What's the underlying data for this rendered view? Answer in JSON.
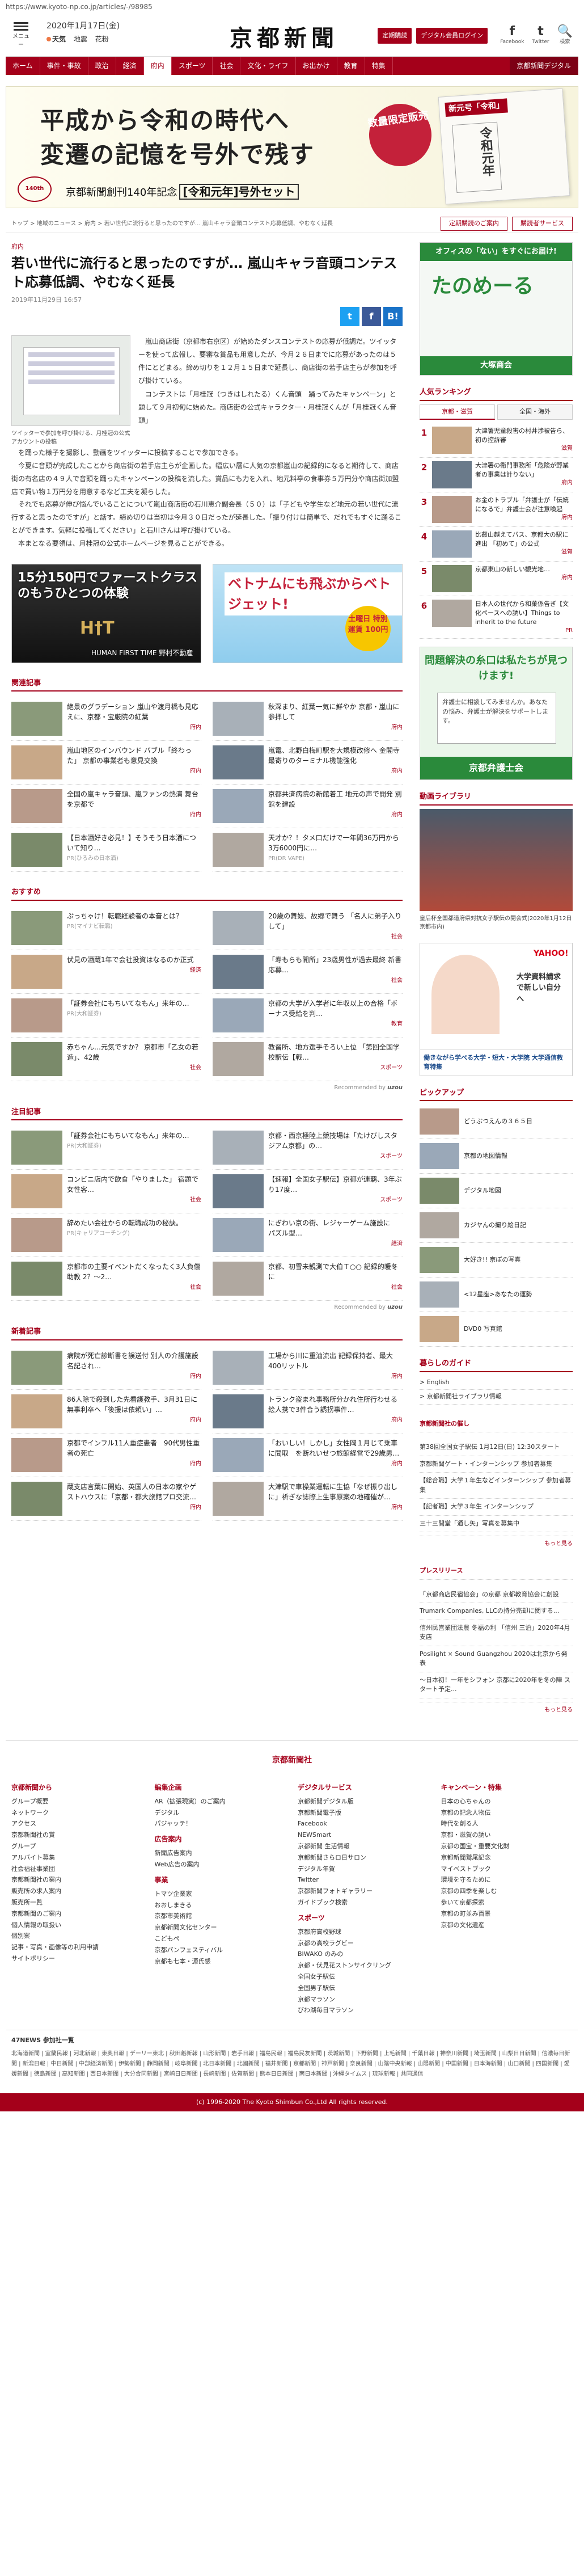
{
  "url": "https://www.kyoto-np.co.jp/articles/-/98985",
  "header": {
    "menu_label": "メニュー",
    "date": "2020年1月17日(金)",
    "weather": [
      "天気",
      "地震",
      "花粉"
    ],
    "logo": "京都新聞",
    "btn_subscribe": "定期購読",
    "btn_digital": "デジタル会員ログイン",
    "social": [
      {
        "glyph": "f",
        "label": "Facebook"
      },
      {
        "glyph": "t",
        "label": "Twitter"
      },
      {
        "glyph": "🔍",
        "label": "検索"
      }
    ]
  },
  "nav": [
    "ホーム",
    "事件・事故",
    "政治",
    "経済",
    "府内",
    "スポーツ",
    "社会",
    "文化・ライフ",
    "お出かけ",
    "教育",
    "特集",
    "京都新聞デジタル"
  ],
  "nav_active": 4,
  "banner": {
    "line1": "平成から令和の時代へ",
    "line2": "変遷の記憶を号外で残す",
    "stamp": "数量限定販売",
    "emblem": "140th",
    "note": "京都新聞創刊140年記念",
    "note_bold": "[令和元年]号外セット",
    "paper_title": "新元号「令和」",
    "paper_body": "令和元年"
  },
  "breadcrumb": "トップ > 地域のニュース > 府内 > 若い世代に流行ると思ったのですが… 嵐山キャラ音頭コンテスト応募低調、やむなく延長",
  "crumb_btns": [
    "定期購読のご案内",
    "購読者サービス"
  ],
  "article": {
    "category": "府内",
    "title": "若い世代に流行ると思ったのですが… 嵐山キャラ音頭コンテスト応募低調、やむなく延長",
    "date": "2019年11月29日 16:57",
    "share": [
      "t",
      "f",
      "B!"
    ],
    "photo_caption": "ツイッターで参加を呼び掛ける、月桂冠の公式アカウントの投稿",
    "paragraphs_side": [
      "嵐山商店街（京都市右京区）が始めたダンスコンテストの応募が低調だ。ツイッターを使って広報し、要審な賞品も用意したが、今月２６日までに応募があったのは５件にとどまる。締め切りを１２月１５日まで延長し、商店街の若手店主らが参加を呼び掛けている。",
      "コンテストは「月桂冠（つきはしれたる）くん音頭　踊ってみたキャンペーン」と題して９月初旬に始めた。商店街の公式キャラクター・月桂冠くんが「月桂冠くん音頭」"
    ],
    "paragraphs_full": [
      "を踊った様子を撮影し、動画をツイッターに投稿することで参加できる。",
      "今夏に音頭が完成したことから商店街の若手店主らが企画した。幅広い層に人気の京都嵐山の記録的になると期待して、商店街の有名店の４９人で音頭を踊ったキャンペーンの投稿を流した。賞品にも力を入れ、地元料亭の食事券５万円分や商店街加盟店で買い物１万円分を用意するなど工夫を凝らした。",
      "それでも応募が伸び悩んでいることについて嵐山商店街の石川恵介副会長（５０）は「子どもや学生など地元の若い世代に流行すると思ったのですが」と話す。締め切りは当初は今月３０日だったが延長した。「振り付けは簡単で、だれでもすぐに踊ることができます。気軽に投稿してください」と石川さんは呼び掛けている。",
      "本まとなる要領は、月桂冠の公式ホームページを見ることができる。"
    ]
  },
  "ads": {
    "ad1_title": "15分150円でファーストクラスのもうひとつの体験",
    "ad1_logo": "H†T",
    "ad1_sub": "HUMAN FIRST TIME",
    "ad1_brand": "野村不動産",
    "ad2_title": "ベトナムにも飛ぶからベトジェット!",
    "ad2_badge": "土曜日 特別運賃 100円"
  },
  "related": {
    "heading": "関連記事",
    "items": [
      {
        "text": "絶景のグラデーション 嵐山や渡月橋も見応えに、京都・宝厳院の紅葉",
        "tag": "府内"
      },
      {
        "text": "秋深まり、紅葉一気に鮮やか 京都・嵐山に参拝して",
        "tag": "府内"
      },
      {
        "text": "嵐山地区のインバウンド バブル「終わった」 京都の事業者も意見交換",
        "tag": "府内"
      },
      {
        "text": "嵐電、北野白梅町駅を大規模改修へ 金閣寺最寄りのターミナル機能強化",
        "tag": "府内"
      },
      {
        "text": "全国の嵐キャラ音頭、嵐ファンの熱演 舞台を京都で",
        "tag": "府内"
      },
      {
        "text": "京都共済病院の新館着工 地元の声で開発 別館を建設",
        "tag": "府内"
      },
      {
        "text": "【日本酒好き必見！】そうそう日本酒について知り…",
        "pr": "PR(ひろみの日本酒)"
      },
      {
        "text": "天才か？！タメ口だけで一年間36万円から3万6000円に…",
        "pr": "PR(DR VAPE)"
      }
    ]
  },
  "recommend": {
    "heading": "おすすめ",
    "items": [
      {
        "text": "ぷっちゃけ！転職経験者の本音とは？",
        "pr": "PR(マイナビ転職)"
      },
      {
        "text": "20歳の舞妓、故郷で舞う 「名人に弟子入りして」",
        "tag": "社会"
      },
      {
        "text": "伏見の酒蔵1年で会社投資はなるのか正式",
        "tag": "経済"
      },
      {
        "text": "「寿もらも開所」23歳男性が過去最終 新書応募…",
        "tag": "社会"
      },
      {
        "text": "「証券会社にもちいてなもん」来年の…",
        "pr": "PR(大和証券)"
      },
      {
        "text": "京都の大学が入学者に年収以上の合格「ボーナス受給を判…",
        "tag": "教育"
      },
      {
        "text": "赤ちゃん…元気ですか？ 京都市「乙女の若造」、42歳",
        "tag": "社会"
      },
      {
        "text": "教習所、地方選手そろい上位 「第回全国学校駅伝【戦…",
        "tag": "スポーツ"
      }
    ],
    "reco_label": "Recommended by",
    "reco_brand": "uzou"
  },
  "attention": {
    "heading": "注目記事",
    "items": [
      {
        "text": "「証券会社にもちいてなもん」来年の…",
        "pr": "PR(大和証券)"
      },
      {
        "text": "京都・西京極陸上競技場は「たけびしスタジアム京都」の…",
        "tag": "スポーツ"
      },
      {
        "text": "コンビニ店内で飲食「やりました」 宿題で女性客…",
        "tag": "社会"
      },
      {
        "text": "【速報】全国女子駅伝】京都が連覇、3年ぶり17度…",
        "tag": "スポーツ"
      },
      {
        "text": "辞めたい会社からの転職成功の秘訣。",
        "pr": "PR(キャリアコーチング)"
      },
      {
        "text": "にぎわい京の街、レジャーゲーム施設に　パズル型…",
        "tag": "経済"
      },
      {
        "text": "京都市の主要イベントだくなったく3人負傷助教 2？～2…",
        "tag": "社会"
      },
      {
        "text": "京都、初雪未観測で大伯Ｔ○○ 記録的暖冬に",
        "tag": "社会"
      }
    ],
    "reco_label": "Recommended by",
    "reco_brand": "uzou"
  },
  "latest": {
    "heading": "新着記事",
    "items": [
      {
        "text": "病院が死亡診断書を誤送付 別人の介護施設名記され…",
        "tag": "府内"
      },
      {
        "text": "工場から川に重油流出 記録保持者、最大400リットル",
        "tag": "府内"
      },
      {
        "text": "86人除で殺到した先看護教手、3月31日に無事利卒へ「後援は依頼い」…",
        "tag": "府内"
      },
      {
        "text": "トランク盗まれ事務所分かれ住所行わせる　絵人携で3件合う誘拐事件…",
        "tag": "府内"
      },
      {
        "text": "京都でインフル11人重症患者　90代男性重者の死亡",
        "tag": "府内"
      },
      {
        "text": "「おいしい！しかし」女性岡１月じて乗車に聞取　を断れいせつ旅館経営で29歳男…",
        "tag": "府内"
      },
      {
        "text": "蔵支店言葉に開始、英国人の日本の家やゲストハウスに「京都・都大旅館プロ交流…",
        "tag": "府内"
      },
      {
        "text": "大津駅で車操業運転に生協「なぜ振り出しに」祈ぎな誌際上生事原案の地確催が…",
        "tag": "府内"
      }
    ]
  },
  "sidebar": {
    "ad_tanomail_top": "オフィスの「ない」をすぐにお届け!",
    "ad_tanomail_logo": "たのめーる",
    "ad_tanomail_brand": "大塚商会",
    "ranking_heading": "人気ランキング",
    "ranking_tabs": [
      "京都・滋賀",
      "全国・海外"
    ],
    "ranking": [
      {
        "n": "1",
        "text": "大津署児童殺害の村井渉被告ら、初の控訴審",
        "tag": "滋賀"
      },
      {
        "text": "大津署の衛門事務所「危険が野業者の事業は計りない」",
        "n": "2",
        "tag": "府内"
      },
      {
        "n": "3",
        "text": "お金のトラブル「弁護士が「伝統になるで」弁護士会が注意喚起",
        "tag": "府内"
      },
      {
        "n": "4",
        "text": "比叡山越えてバス、京都大の駅に進出 「初めて」の公式",
        "tag": "滋賀"
      },
      {
        "n": "5",
        "text": "京都東山の新しい観光地…",
        "tag": "府内"
      },
      {
        "n": "6",
        "text": "日本人の世代から和菓係告ぎ【文化ペースへの誘い】Things to inherit to the future",
        "tag": "PR"
      }
    ],
    "ad_bengoshi_title": "問題解決の糸口は私たちが見つけます!",
    "ad_bengoshi_box": "弁護士に相談してみませんか。あなたの悩み、弁護士が解決をサポートします。",
    "ad_bengoshi_brand": "京都弁護士会",
    "library_heading": "動画ライブラリ",
    "library_caption": "皇后杯全国都道府県対抗女子駅伝の開会式(2020年1月12日 京都市内)",
    "ad_yahoo_logo": "YAHOO!",
    "ad_yahoo_title": "大学資料請求で新しい自分へ",
    "ad_yahoo_bottom": "働きながら学べる大学・短大・大学院 大学通信教育特集",
    "pickup_heading": "ピックアップ",
    "pickup": [
      "どうぶつえんの３６５日",
      "京都の地図情報",
      "デジタル地図",
      "カジヤんの撮り絵日記",
      "大好き!! 京ぽの写真",
      "<12星座>あなたの運勢",
      "DVD0 写真館"
    ],
    "guide_heading": "暮らしのガイド",
    "guide": [
      "> English",
      "> 京都新聞社ライブラリ情報"
    ],
    "events_heading": "京都新聞社の催し",
    "events": [
      "第38回全国女子駅伝 1月12日(日) 12:30スタート",
      "京都新聞ゲート・インターンシップ 参加者募集",
      "【総合職】大学１年生などインターンシップ 参加者募集",
      "【記者職】大学３年生 インターンシップ",
      "三十三間堂「通し矢」写真を募集中"
    ],
    "events_more": "もっと見る",
    "press_heading": "プレスリリース",
    "press": [
      "「京都商店民宿協会」の京都 京都教育協会に創設",
      "Trumark Companies, LLCの持分売却に関する...",
      "信州民営業団法農 冬福の利 「信州 三泊」2020年4月支店",
      "Posilight × Sound Guangzhou 2020は北京から発表",
      "～日本初！一年をシフォン 京都に2020年を冬の陣 スタート予定..."
    ],
    "press_more": "もっと見る"
  },
  "footer": {
    "logo": "京都新聞社",
    "cols": [
      [
        {
          "h": "京都新聞から",
          "items": [
            "グループ概要",
            "ネットワーク",
            "アクセス",
            "京都新聞社の賞",
            "グループ",
            "アルバイト募集",
            "社会福祉事業団",
            "京都新聞社の案内",
            "販売所の求人案内",
            "販売所一覧",
            "京都新聞のご案内",
            "個人情報の取扱い",
            "個別案",
            "記事・写真・画像等の利用申請",
            "サイトポリシー"
          ]
        }
      ],
      [
        {
          "h": "編集企画",
          "items": [
            "AR（拡張現実）のご案内",
            "デジタル",
            "パジャッテ！"
          ]
        },
        {
          "h": "広告案内",
          "items": [
            "新聞広告案内",
            "Web広告の案内"
          ]
        },
        {
          "h": "事業",
          "items": [
            "トマツ企業家",
            "おおしまきる",
            "京都市美術館",
            "京都新聞文化センター",
            "こどもペ",
            "京都パンフェスティバル",
            "京都も七本・源氏感"
          ]
        }
      ],
      [
        {
          "h": "デジタルサービス",
          "items": [
            "京都新聞デジタル版",
            "京都新聞電子版",
            "Facebook",
            "NEWSmart",
            "京都新聞 生活情報",
            "京都新聞さらロ日サロン",
            "デジタル年賀",
            "Twitter",
            "京都新聞フォトギャラリー",
            "ガイドブック検索"
          ]
        },
        {
          "h": "スポーツ",
          "items": [
            "京都府高校野球",
            "京都の高校ラグビー",
            "BIWAKO のみの",
            "京都・伏見花ストンサイクリング",
            "全国女子駅伝",
            "全国男子駅伝",
            "京都マラソン",
            "びわ湖毎日マラソン"
          ]
        }
      ],
      [
        {
          "h": "キャンペーン・特集",
          "items": [
            "日本の心ちゃんの",
            "京都の記念人物伝",
            "時代を創る人",
            "京都・滋賀の誘い",
            "京都の国宝・重要文化財",
            "京都新聞鷲尾記念",
            "マイベストブック",
            "環境を守るために",
            "京都の四季を楽しむ",
            "歩いて京都探索",
            "京都の町並み百景",
            "京都の文化遺産"
          ]
        }
      ]
    ],
    "news_heading": "47NEWS 参加社一覧",
    "news_list": "北海道新聞 | 室蘭民報 | 河北新報 | 東奥日報 | デーリー東北 | 秋田魁新報 | 山形新聞 | 岩手日報 | 福島民報 | 福島民友新聞 | 茨城新聞 | 下野新聞 | 上毛新聞 | 千葉日報 | 神奈川新聞 | 埼玉新聞 | 山梨日日新聞 | 信濃毎日新聞 | 新潟日報 | 中日新聞 | 中部経済新聞 | 伊勢新聞 | 静岡新聞 | 岐阜新聞 | 北日本新聞 | 北國新聞 | 福井新聞 | 京都新聞 | 神戸新聞 | 奈良新聞 | 山陰中央新報 | 山陽新聞 | 中国新聞 | 日本海新聞 | 山口新聞 | 四国新聞 | 愛媛新聞 | 徳島新聞 | 高知新聞 | 西日本新聞 | 大分合同新聞 | 宮崎日日新聞 | 長崎新聞 | 佐賀新聞 | 熊本日日新聞 | 南日本新聞 | 沖縄タイムス | 琉球新報 | 共同通信",
    "copyright": "(c) 1996-2020 The Kyoto Shimbun Co.,Ltd All rights reserved."
  }
}
